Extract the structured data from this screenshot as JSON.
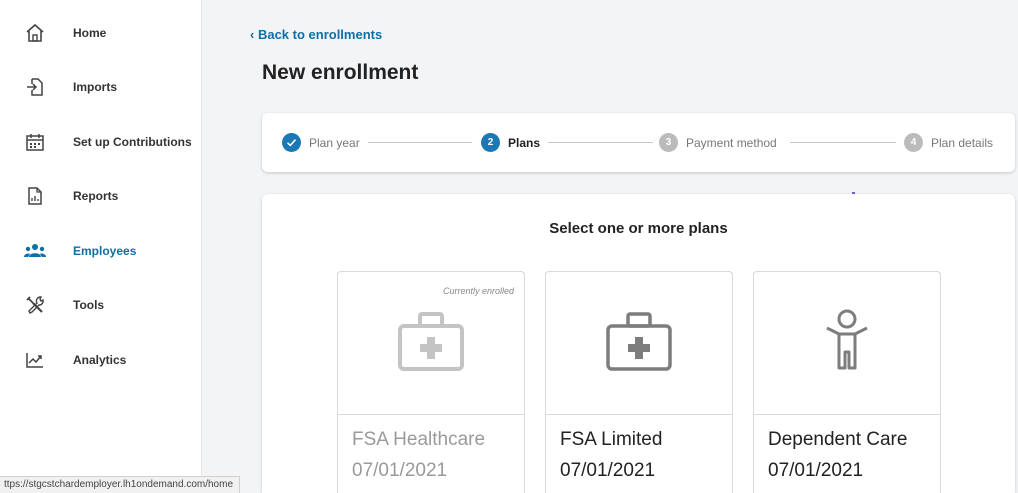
{
  "sidebar": {
    "items": [
      {
        "label": "Home",
        "icon": "home-icon",
        "active": false
      },
      {
        "label": "Imports",
        "icon": "import-icon",
        "active": false
      },
      {
        "label": "Set up Contributions",
        "icon": "calendar-icon",
        "active": false
      },
      {
        "label": "Reports",
        "icon": "report-icon",
        "active": false
      },
      {
        "label": "Employees",
        "icon": "people-icon",
        "active": true
      },
      {
        "label": "Tools",
        "icon": "tools-icon",
        "active": false
      },
      {
        "label": "Analytics",
        "icon": "analytics-icon",
        "active": false
      }
    ],
    "active_color": "#0e6fa6"
  },
  "status_url": "ttps://stgcstchardemployer.lh1ondemand.com/home",
  "main": {
    "back_link": "Back to enrollments",
    "title": "New enrollment"
  },
  "stepper": {
    "steps": [
      {
        "number": "1",
        "label": "Plan year",
        "state": "done"
      },
      {
        "number": "2",
        "label": "Plans",
        "state": "current"
      },
      {
        "number": "3",
        "label": "Payment method",
        "state": "pending"
      },
      {
        "number": "4",
        "label": "Plan details",
        "state": "pending"
      }
    ],
    "accent": "#1b78b5"
  },
  "plans": {
    "heading": "Select one or more plans",
    "cards": [
      {
        "name": "FSA Healthcare",
        "date": "07/01/2021",
        "badge": "Currently enrolled",
        "icon": "medical-kit-icon",
        "enrolled": true
      },
      {
        "name": "FSA Limited",
        "date": "07/01/2021",
        "badge": "",
        "icon": "medical-kit-icon",
        "enrolled": false
      },
      {
        "name": "Dependent Care",
        "date": "07/01/2021",
        "badge": "",
        "icon": "child-icon",
        "enrolled": false
      }
    ]
  }
}
